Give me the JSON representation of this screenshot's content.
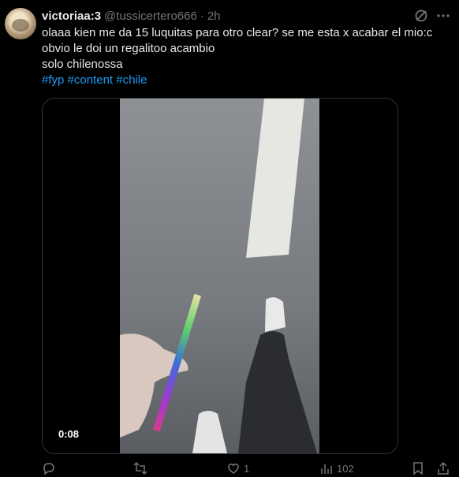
{
  "tweet": {
    "display_name": "victoriaa:3",
    "handle": "@tussicertero666",
    "separator": "·",
    "time": "2h",
    "lines": [
      "olaaa kien me da 15 luquitas para otro clear? se me esta x acabar el mio:c",
      "obvio le doi un regalitoo acambio",
      "solo chilenossa"
    ],
    "hashtags": [
      "#fyp",
      "#content",
      "#chile"
    ],
    "video_duration": "0:08",
    "likes_count": "1",
    "views_count": "102"
  },
  "icons": {
    "grok": "grok-icon",
    "more": "more-horizontal-icon",
    "reply": "reply-icon",
    "retweet": "retweet-icon",
    "like": "heart-icon",
    "views": "views-icon",
    "bookmark": "bookmark-icon",
    "share": "share-icon"
  },
  "colors": {
    "background": "#000000",
    "text": "#e7e9ea",
    "muted": "#71767b",
    "accent": "#1d9bf0"
  }
}
